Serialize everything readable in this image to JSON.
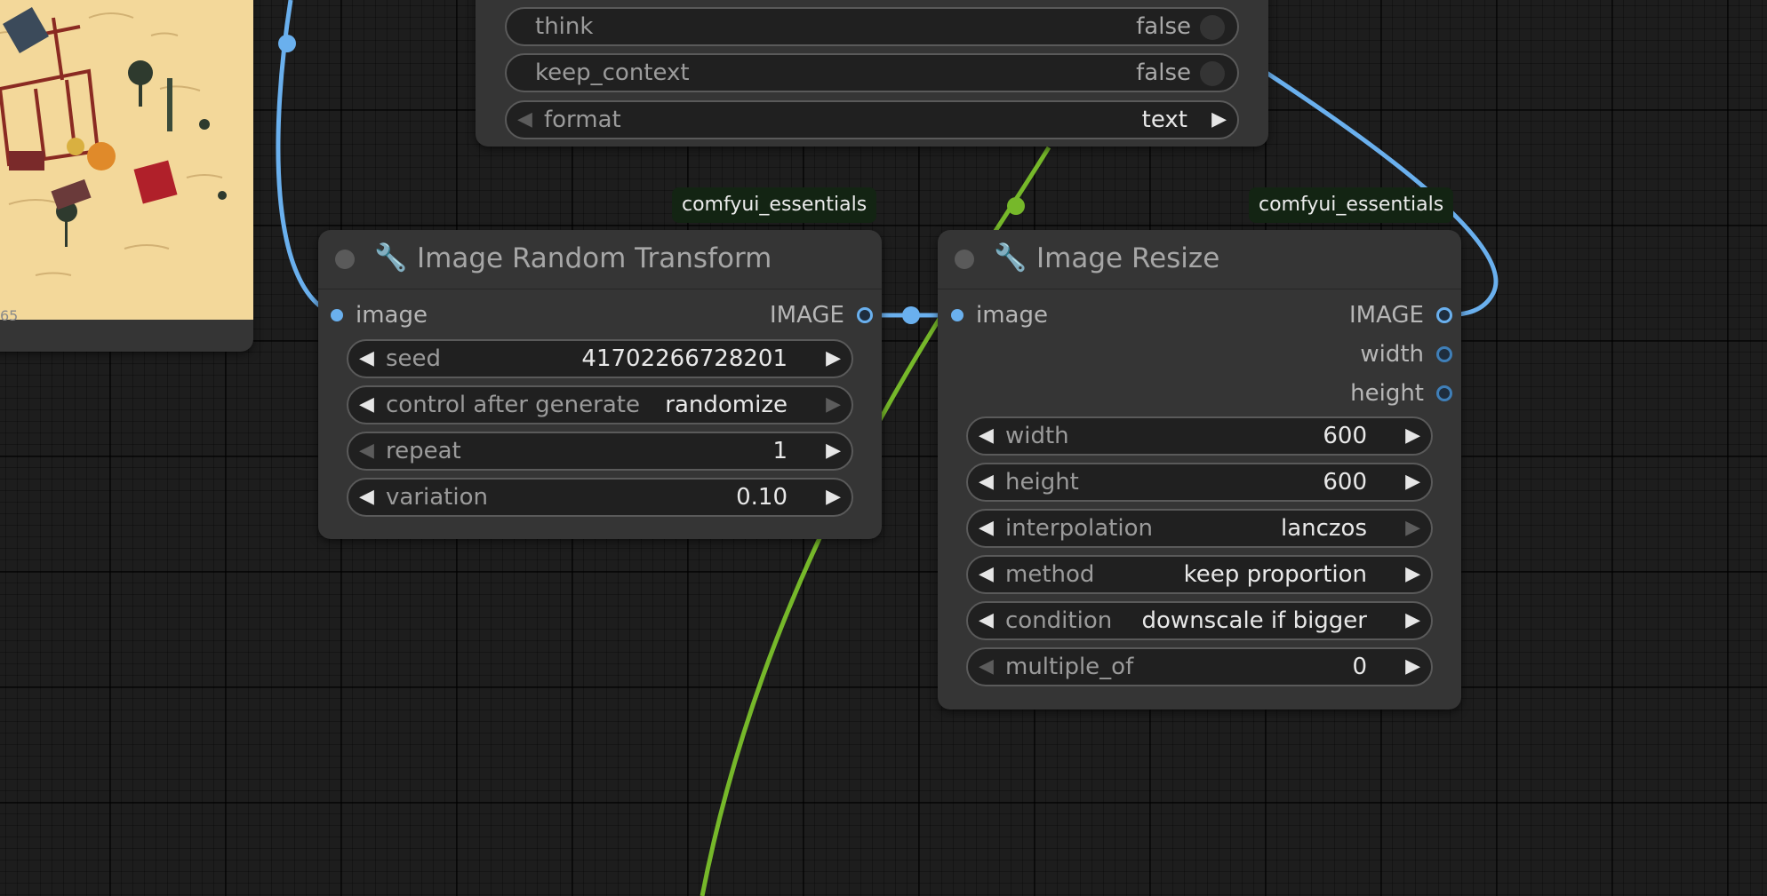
{
  "colors": {
    "canvas_bg": "#1d1d1d",
    "node_bg": "#353535",
    "widget_bg": "#202020",
    "image_link": "#6ab0ee",
    "green_link": "#76b82a",
    "badge_bg": "#132413"
  },
  "preview_node": {
    "caption": "65"
  },
  "top_node": {
    "widgets": [
      {
        "label": "think",
        "value": "false",
        "type": "toggle"
      },
      {
        "label": "keep_context",
        "value": "false",
        "type": "toggle"
      },
      {
        "label": "format",
        "value": "text",
        "type": "combo"
      }
    ]
  },
  "random_transform": {
    "badge": "comfyui_essentials",
    "title": "Image Random Transform",
    "icon": "wrench-icon",
    "input_label": "image",
    "output_label": "IMAGE",
    "widgets": [
      {
        "label": "seed",
        "value": "41702266728201"
      },
      {
        "label": "control after generate",
        "value": "randomize"
      },
      {
        "label": "repeat",
        "value": "1"
      },
      {
        "label": "variation",
        "value": "0.10"
      }
    ]
  },
  "image_resize": {
    "badge": "comfyui_essentials",
    "title": "Image Resize",
    "icon": "wrench-icon",
    "input_label": "image",
    "outputs": [
      "IMAGE",
      "width",
      "height"
    ],
    "widgets": [
      {
        "label": "width",
        "value": "600"
      },
      {
        "label": "height",
        "value": "600"
      },
      {
        "label": "interpolation",
        "value": "lanczos"
      },
      {
        "label": "method",
        "value": "keep proportion"
      },
      {
        "label": "condition",
        "value": "downscale if bigger"
      },
      {
        "label": "multiple_of",
        "value": "0"
      }
    ]
  }
}
